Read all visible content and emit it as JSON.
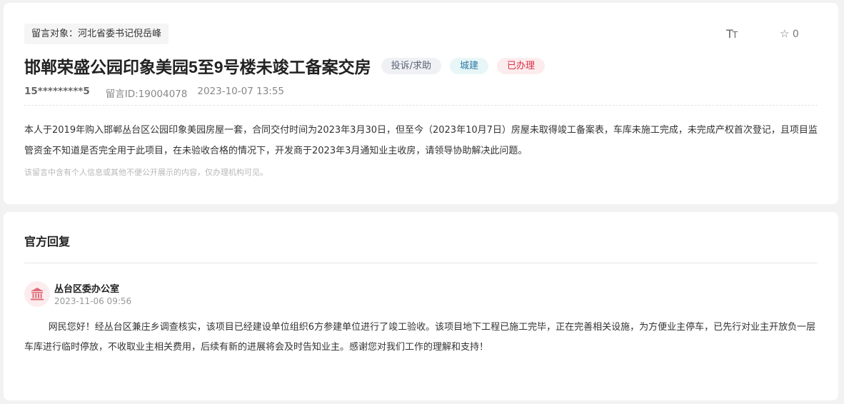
{
  "message": {
    "target": "留言对象：河北省委书记倪岳峰",
    "font_tool_label": "T",
    "font_tool_label_small": "T",
    "favorite_count": "0",
    "title": "邯郸荣盛公园印象美园5至9号楼未竣工备案交房",
    "badges": {
      "type": "投诉/求助",
      "category": "城建",
      "status": "已办理"
    },
    "user": "15*********5",
    "message_id": "留言ID:19004078",
    "timestamp": "2023-10-07 13:55",
    "content": "本人于2019年购入邯郸丛台区公园印象美园房屋一套，合同交付时间为2023年3月30日，但至今（2023年10月7日）房屋未取得竣工备案表，车库未施工完成，未完成产权首次登记，且项目监管资金不知道是否完全用于此项目，在未验收合格的情况下，开发商于2023年3月通知业主收房，请领导协助解决此问题。",
    "privacy_note": "该留言中含有个人信息或其他不便公开展示的内容，仅办理机构可见。"
  },
  "reply": {
    "section_title": "官方回复",
    "department": "丛台区委办公室",
    "timestamp": "2023-11-06 09:56",
    "content": "网民您好！经丛台区兼庄乡调查核实，该项目已经建设单位组织6方参建单位进行了竣工验收。该项目地下工程已施工完毕，正在完善相关设施，为方便业主停车，已先行对业主开放负一层车库进行临时停放，不收取业主相关费用，后续有新的进展将会及时告知业主。感谢您对我们工作的理解和支持！"
  },
  "icons": {
    "font_size": "font-size-icon",
    "favorite": "star-icon",
    "department_avatar": "government-building-icon"
  },
  "colors": {
    "status_red": "#d93045",
    "category_blue": "#2d79a6"
  }
}
